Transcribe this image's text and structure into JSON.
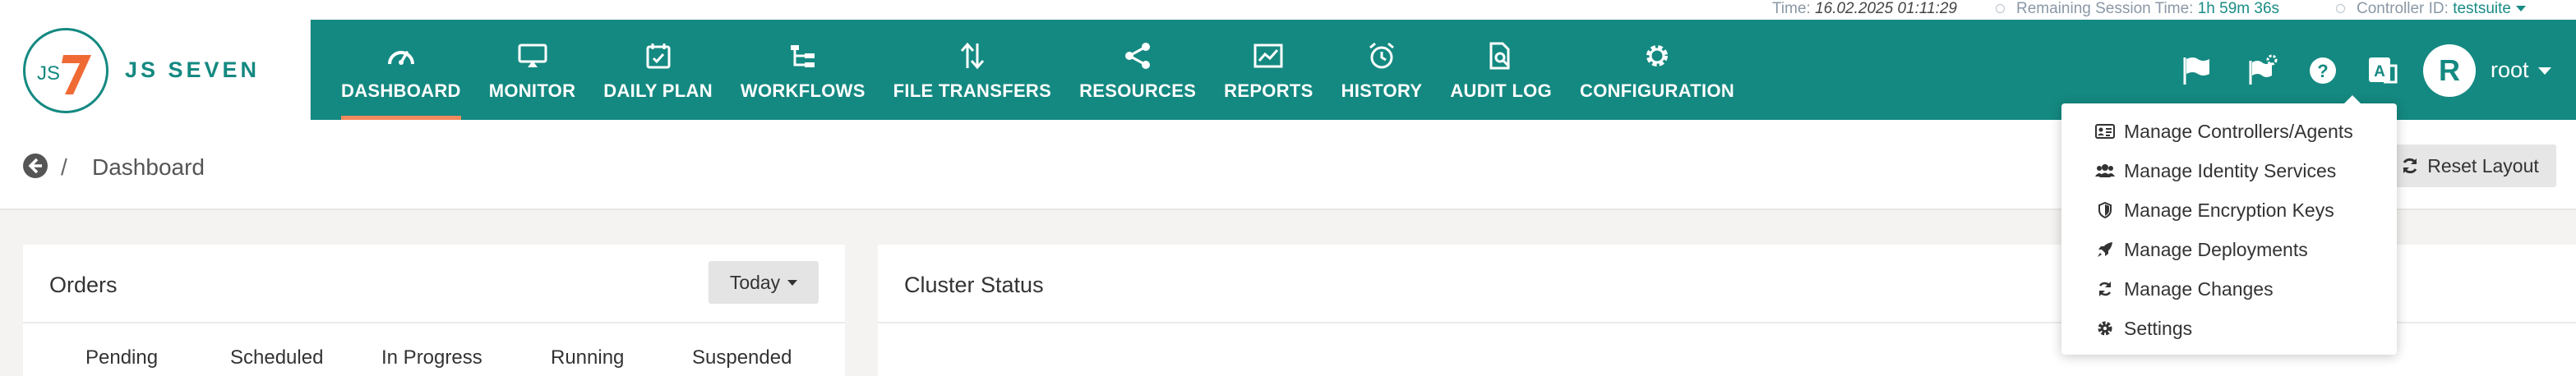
{
  "status": {
    "time_label": "Time:",
    "time_value": "16.02.2025 01:11:29",
    "session_label": "Remaining Session Time:",
    "session_value": "1h 59m 36s",
    "controller_label": "Controller ID:",
    "controller_value": "testsuite"
  },
  "brand": {
    "logo_text": "JS SEVEN",
    "badge": "JS"
  },
  "nav": {
    "items": [
      {
        "label": "DASHBOARD",
        "icon": "dashboard-gauge-icon"
      },
      {
        "label": "MONITOR",
        "icon": "monitor-icon"
      },
      {
        "label": "DAILY PLAN",
        "icon": "calendar-icon"
      },
      {
        "label": "WORKFLOWS",
        "icon": "workflow-icon"
      },
      {
        "label": "FILE TRANSFERS",
        "icon": "transfer-arrows-icon"
      },
      {
        "label": "RESOURCES",
        "icon": "share-nodes-icon"
      },
      {
        "label": "REPORTS",
        "icon": "line-chart-icon"
      },
      {
        "label": "HISTORY",
        "icon": "alarm-clock-icon"
      },
      {
        "label": "AUDIT LOG",
        "icon": "file-search-icon"
      },
      {
        "label": "CONFIGURATION",
        "icon": "gear-icon"
      }
    ],
    "active_index": 0
  },
  "header_right": {
    "icons": [
      "flag-icon",
      "flag-gear-icon",
      "help-icon",
      "language-icon"
    ],
    "avatar_initial": "R",
    "user": "root"
  },
  "breadcrumb": {
    "separator": "/",
    "title": "Dashboard"
  },
  "toolbar": {
    "reset_label": "Reset Layout"
  },
  "orders": {
    "title": "Orders",
    "period": "Today",
    "columns": [
      "Pending",
      "Scheduled",
      "In Progress",
      "Running",
      "Suspended"
    ]
  },
  "cluster": {
    "title": "Cluster Status"
  },
  "config_menu": {
    "items": [
      {
        "label": "Manage Controllers/Agents",
        "icon": "id-card-icon"
      },
      {
        "label": "Manage Identity Services",
        "icon": "users-icon"
      },
      {
        "label": "Manage Encryption Keys",
        "icon": "shield-icon"
      },
      {
        "label": "Manage Deployments",
        "icon": "rocket-icon"
      },
      {
        "label": "Manage Changes",
        "icon": "refresh-icon"
      },
      {
        "label": "Settings",
        "icon": "gear-icon"
      }
    ]
  },
  "colors": {
    "header": "#148981",
    "accent": "#f28a5e",
    "status_value": "#1a8c86"
  }
}
